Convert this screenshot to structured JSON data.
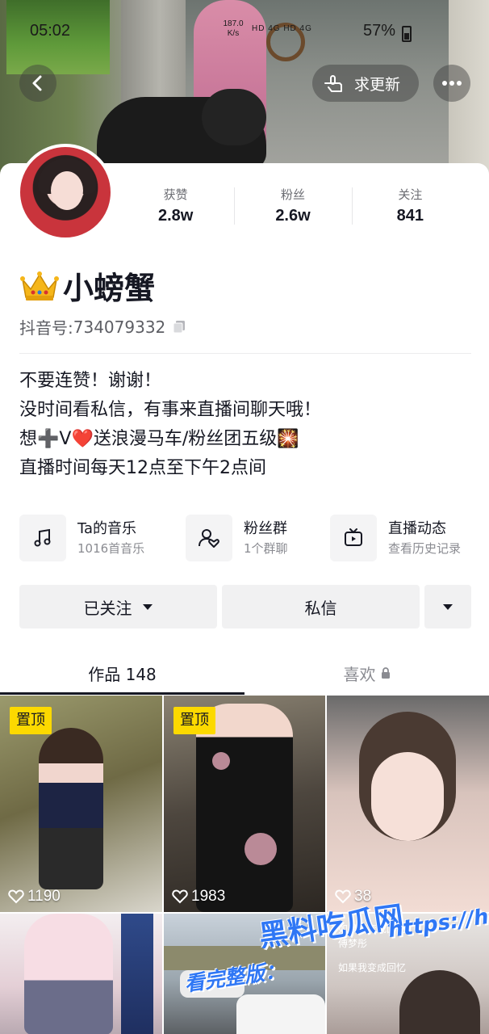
{
  "status_bar": {
    "time": "05:02",
    "speed_value": "187.0",
    "speed_unit": "K/s",
    "network": "HD 4G HD 4G",
    "battery": "57%"
  },
  "header": {
    "update_label": "求更新"
  },
  "profile": {
    "stats": [
      {
        "label": "获赞",
        "value": "2.8w"
      },
      {
        "label": "粉丝",
        "value": "2.6w"
      },
      {
        "label": "关注",
        "value": "841"
      }
    ],
    "name": "小螃蟹",
    "douyin_id_label": "抖音号: ",
    "douyin_id": "734079332",
    "bio": [
      "不要连赞！谢谢！",
      "没时间看私信，有事来直播间聊天哦！",
      "想➕V❤️送浪漫马车/粉丝团五级🎇",
      "直播时间每天12点至下午2点间"
    ]
  },
  "features": [
    {
      "title": "Ta的音乐",
      "sub": "1016首音乐",
      "icon": "music-note-icon"
    },
    {
      "title": "粉丝群",
      "sub": "1个群聊",
      "icon": "fan-group-icon"
    },
    {
      "title": "直播动态",
      "sub": "查看历史记录",
      "icon": "live-tv-icon"
    }
  ],
  "actions": {
    "followed": "已关注",
    "message": "私信"
  },
  "tabs": {
    "works": "作品 148",
    "likes": "喜欢"
  },
  "grid": [
    {
      "pinned": "置顶",
      "likes": "1190"
    },
    {
      "pinned": "置顶",
      "likes": "1983"
    },
    {
      "likes": "38"
    }
  ],
  "grid_overlay_text": {
    "cell6_line1": "如果我变成回忆",
    "cell6_line2": "傅梦彤",
    "cell6_line3": "如果我变成回忆"
  },
  "watermark": {
    "site_name": "黑料吃瓜网",
    "url": "https://hlcgw.net",
    "prompt": "看完整版："
  },
  "colors": {
    "pin_badge": "#fcd900",
    "watermark": "#2f77f5",
    "text_primary": "#161823",
    "text_secondary": "#8a8b91"
  }
}
